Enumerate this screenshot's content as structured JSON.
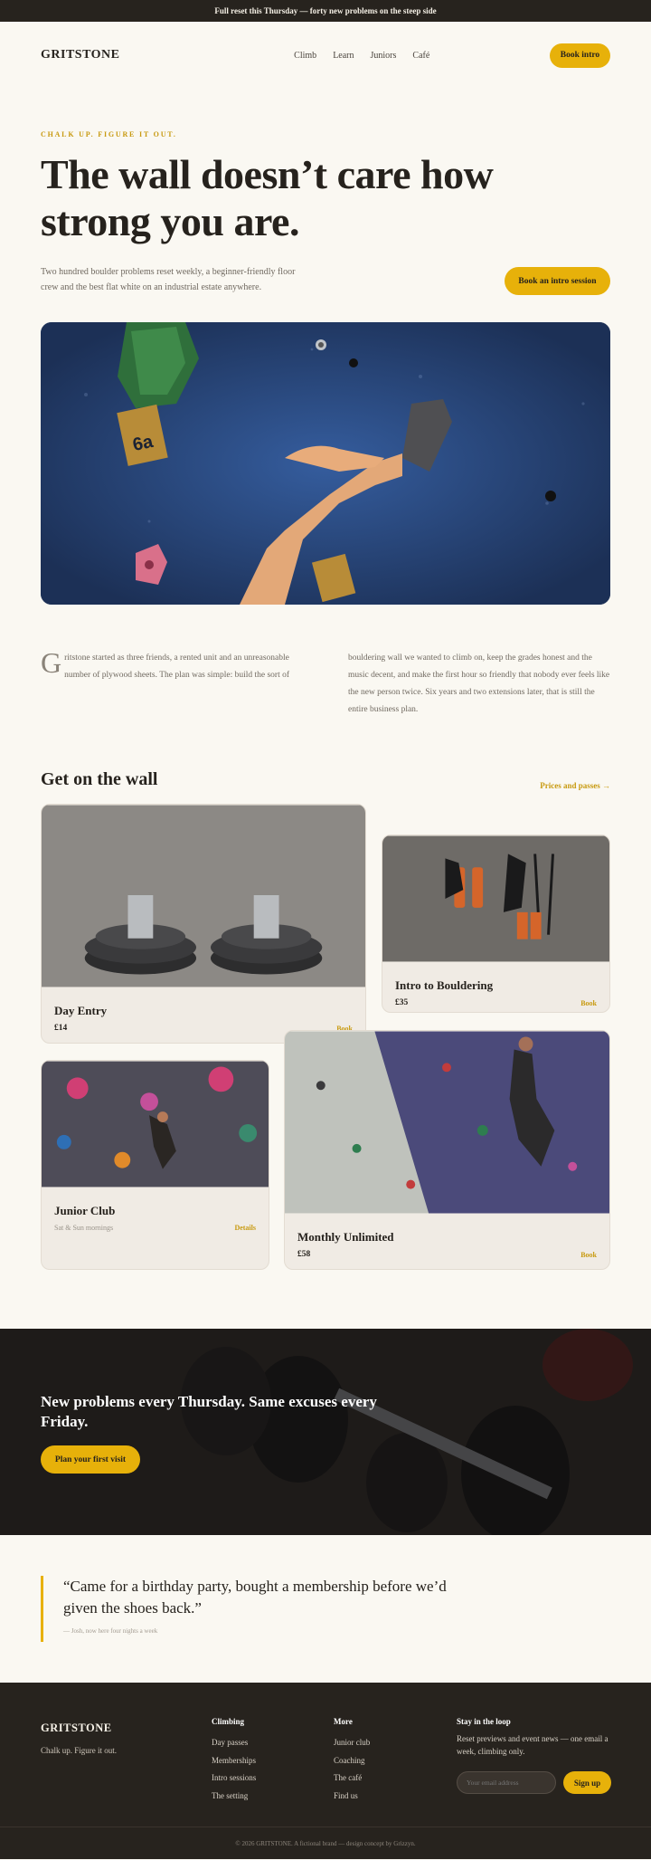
{
  "announcement": "Full reset this Thursday — forty new problems on the steep side",
  "nav": {
    "brand": "GRITSTONE",
    "links": [
      "Climb",
      "Learn",
      "Juniors",
      "Café"
    ],
    "cta": "Book intro"
  },
  "hero": {
    "eyebrow": "CHALK UP. FIGURE IT OUT.",
    "title": "The wall doesn’t care how strong you are.",
    "text": "Two hundred boulder problems reset weekly, a beginner-friendly floor crew and the best flat white on an industrial estate anywhere.",
    "cta": "Book an intro session",
    "image": "climbing-hand-on-blue-wall"
  },
  "story": {
    "dropcap": "G",
    "col1": "ritstone started as three friends, a rented unit and an unreasonable number of plywood sheets. The plan was simple: build the sort of",
    "col2": "bouldering wall we wanted to climb on, keep the grades honest and the music decent, and make the first hour so friendly that nobody ever feels like the new person twice. Six years and two extensions later, that is still the entire business plan."
  },
  "wall": {
    "heading": "Get on the wall",
    "link": "Prices and passes →",
    "cards": [
      {
        "title": "Day Entry",
        "price": "£14",
        "link": "Book"
      },
      {
        "title": "Intro to Bouldering",
        "price": "£35",
        "link": "Book"
      },
      {
        "title": "Junior Club",
        "meta": "Sat & Sun mornings",
        "link": "Details"
      },
      {
        "title": "Monthly Unlimited",
        "price": "£58",
        "link": "Book"
      }
    ]
  },
  "banner": {
    "title": "New problems every Thursday. Same excuses every Friday.",
    "cta": "Plan your first visit"
  },
  "quote": {
    "text": "“Came for a birthday party, bought a membership before we’d given the shoes back.”",
    "cite": "— Josh, now here four nights a week"
  },
  "footer": {
    "brand": "GRITSTONE",
    "tagline": "Chalk up. Figure it out.",
    "climbing": {
      "heading": "Climbing",
      "items": [
        "Day passes",
        "Memberships",
        "Intro sessions",
        "The setting"
      ]
    },
    "more": {
      "heading": "More",
      "items": [
        "Junior club",
        "Coaching",
        "The café",
        "Find us"
      ]
    },
    "newsletter": {
      "heading": "Stay in the loop",
      "text": "Reset previews and event news — one email a week, climbing only.",
      "placeholder": "Your email address",
      "button": "Sign up"
    },
    "copyright": "© 2026 GRITSTONE. A fictional brand — design concept by Grizzyn."
  }
}
